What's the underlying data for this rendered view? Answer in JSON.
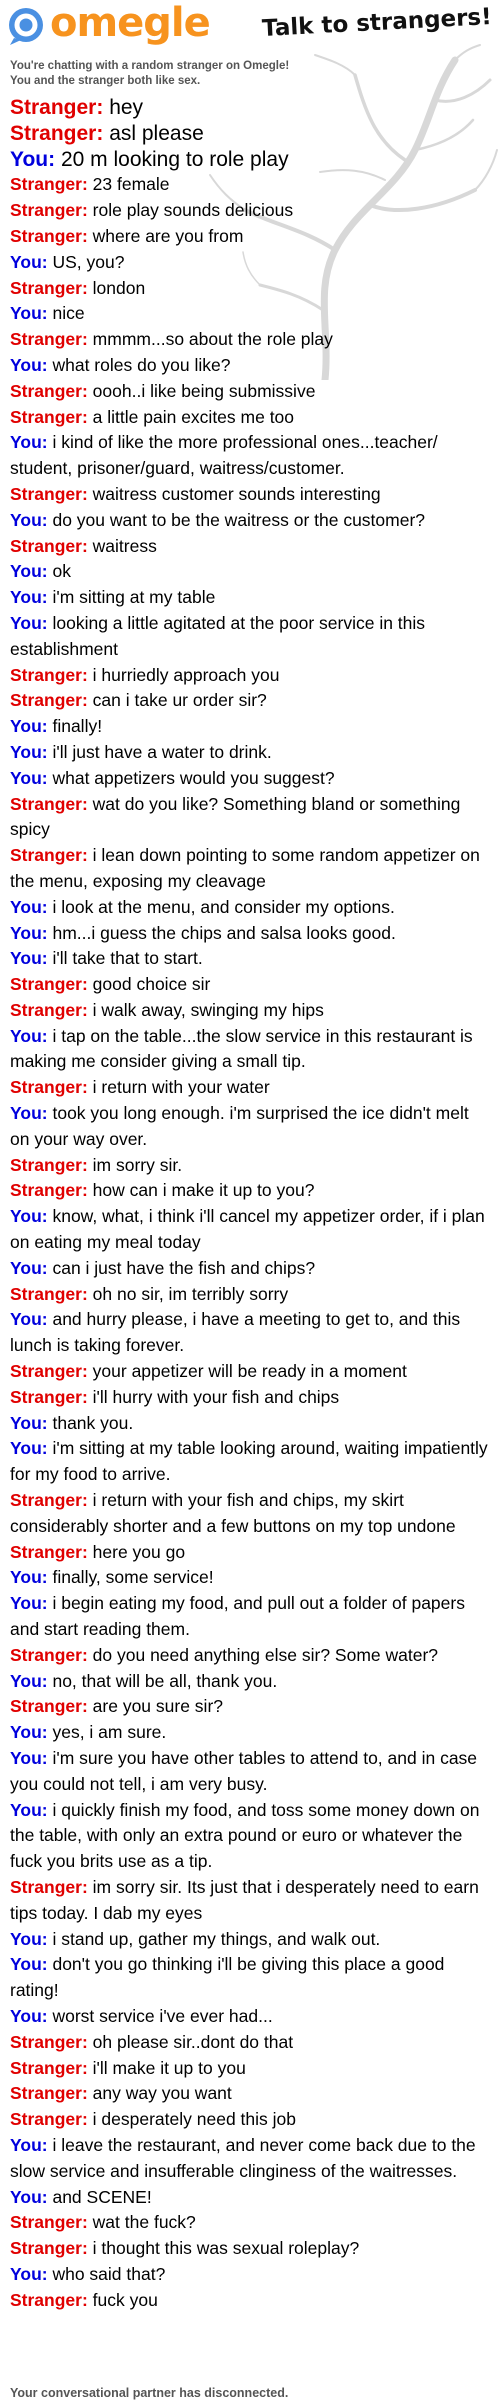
{
  "header": {
    "logo_text": "omegle",
    "tagline": "Talk to strangers!",
    "notice_line1": "You're chatting with a random stranger on Omegle!",
    "notice_line2": "You and the stranger both like sex."
  },
  "speakers": {
    "stranger": "Stranger:",
    "you": "You:"
  },
  "colors": {
    "stranger": "#e00000",
    "you": "#0000dd",
    "logo": "#f7931e"
  },
  "messages": [
    {
      "who": "stranger",
      "text": "hey",
      "big": true
    },
    {
      "who": "stranger",
      "text": "asl please",
      "big": true
    },
    {
      "who": "you",
      "text": "20 m looking to role play",
      "big": true
    },
    {
      "who": "stranger",
      "text": "23 female"
    },
    {
      "who": "stranger",
      "text": "role play sounds delicious"
    },
    {
      "who": "stranger",
      "text": "where are you from"
    },
    {
      "who": "you",
      "text": "US, you?"
    },
    {
      "who": "stranger",
      "text": "london"
    },
    {
      "who": "you",
      "text": "nice"
    },
    {
      "who": "stranger",
      "text": "mmmm...so about the role play"
    },
    {
      "who": "you",
      "text": "what roles do you like?"
    },
    {
      "who": "stranger",
      "text": "oooh..i like being submissive"
    },
    {
      "who": "stranger",
      "text": "a little pain excites me too"
    },
    {
      "who": "you",
      "text": "i kind of like the more professional ones...teacher/ student, prisoner/guard, waitress/customer."
    },
    {
      "who": "stranger",
      "text": "waitress customer sounds interesting"
    },
    {
      "who": "you",
      "text": "do you want to be the waitress or the customer?"
    },
    {
      "who": "stranger",
      "text": "waitress"
    },
    {
      "who": "you",
      "text": "ok"
    },
    {
      "who": "you",
      "text": "i'm sitting at my table"
    },
    {
      "who": "you",
      "text": "looking a little agitated at the poor service in this establishment"
    },
    {
      "who": "stranger",
      "text": "i hurriedly approach you"
    },
    {
      "who": "stranger",
      "text": "can i take ur order sir?"
    },
    {
      "who": "you",
      "text": "finally!"
    },
    {
      "who": "you",
      "text": "i'll just have a water to drink."
    },
    {
      "who": "you",
      "text": "what appetizers would you suggest?"
    },
    {
      "who": "stranger",
      "text": "wat do you like? Something bland or something spicy"
    },
    {
      "who": "stranger",
      "text": "i lean down pointing to some random appetizer on the menu, exposing my cleavage"
    },
    {
      "who": "you",
      "text": "i look at the menu, and consider my options."
    },
    {
      "who": "you",
      "text": "hm...i guess the chips and salsa looks good."
    },
    {
      "who": "you",
      "text": "i'll take that to start."
    },
    {
      "who": "stranger",
      "text": "good choice sir"
    },
    {
      "who": "stranger",
      "text": "i walk away, swinging my hips"
    },
    {
      "who": "you",
      "text": "i tap on the table...the slow service in this restaurant is making me consider giving a small tip."
    },
    {
      "who": "stranger",
      "text": "i return with your water"
    },
    {
      "who": "you",
      "text": "took you long enough. i'm surprised the ice didn't melt on your way over."
    },
    {
      "who": "stranger",
      "text": "im sorry sir."
    },
    {
      "who": "stranger",
      "text": "how can i make it up to you?"
    },
    {
      "who": "you",
      "text": "know, what, i think i'll cancel my appetizer order, if i plan on eating my meal today"
    },
    {
      "who": "you",
      "text": "can i just have the fish and chips?"
    },
    {
      "who": "stranger",
      "text": "oh no sir, im terribly sorry"
    },
    {
      "who": "you",
      "text": "and hurry please, i have a meeting to get to, and this lunch is taking forever."
    },
    {
      "who": "stranger",
      "text": "your appetizer will be ready in a moment"
    },
    {
      "who": "stranger",
      "text": "i'll hurry with your fish and chips"
    },
    {
      "who": "you",
      "text": "thank you."
    },
    {
      "who": "you",
      "text": "i'm sitting at my table looking around, waiting impatiently for my food to arrive."
    },
    {
      "who": "stranger",
      "text": "i return with your fish and chips, my skirt considerably shorter and a few buttons on my top undone"
    },
    {
      "who": "stranger",
      "text": "here you go"
    },
    {
      "who": "you",
      "text": "finally, some service!"
    },
    {
      "who": "you",
      "text": "i begin eating my food, and pull out a folder of papers and start reading them."
    },
    {
      "who": "stranger",
      "text": "do you need anything else sir? Some water?"
    },
    {
      "who": "you",
      "text": "no, that will be all, thank you."
    },
    {
      "who": "stranger",
      "text": "are you sure sir?"
    },
    {
      "who": "you",
      "text": "yes, i am sure."
    },
    {
      "who": "you",
      "text": "i'm sure you have other tables to attend to, and in case you could not tell, i am very busy."
    },
    {
      "who": "you",
      "text": "i quickly finish my food, and toss some money down on the table, with only an extra pound or euro or whatever the fuck you brits use as a tip."
    },
    {
      "who": "stranger",
      "text": "im sorry sir. Its just that i desperately need to earn tips today. I dab my eyes"
    },
    {
      "who": "you",
      "text": "i stand up, gather my things, and walk out."
    },
    {
      "who": "you",
      "text": "don't you go thinking i'll be giving this place a good rating!"
    },
    {
      "who": "you",
      "text": "worst service i've ever had..."
    },
    {
      "who": "stranger",
      "text": "oh please sir..dont do that"
    },
    {
      "who": "stranger",
      "text": "i'll make it up to you"
    },
    {
      "who": "stranger",
      "text": "any way you want"
    },
    {
      "who": "stranger",
      "text": "i desperately need this job"
    },
    {
      "who": "you",
      "text": "i leave the restaurant, and never come back due to the slow service and insufferable clinginess of the waitresses."
    },
    {
      "who": "you",
      "text": "and SCENE!"
    },
    {
      "who": "stranger",
      "text": "wat the fuck?"
    },
    {
      "who": "stranger",
      "text": "i thought this was sexual roleplay?"
    },
    {
      "who": "you",
      "text": "who said that?"
    },
    {
      "who": "stranger",
      "text": "fuck you"
    }
  ],
  "status": "Your conversational partner has disconnected."
}
